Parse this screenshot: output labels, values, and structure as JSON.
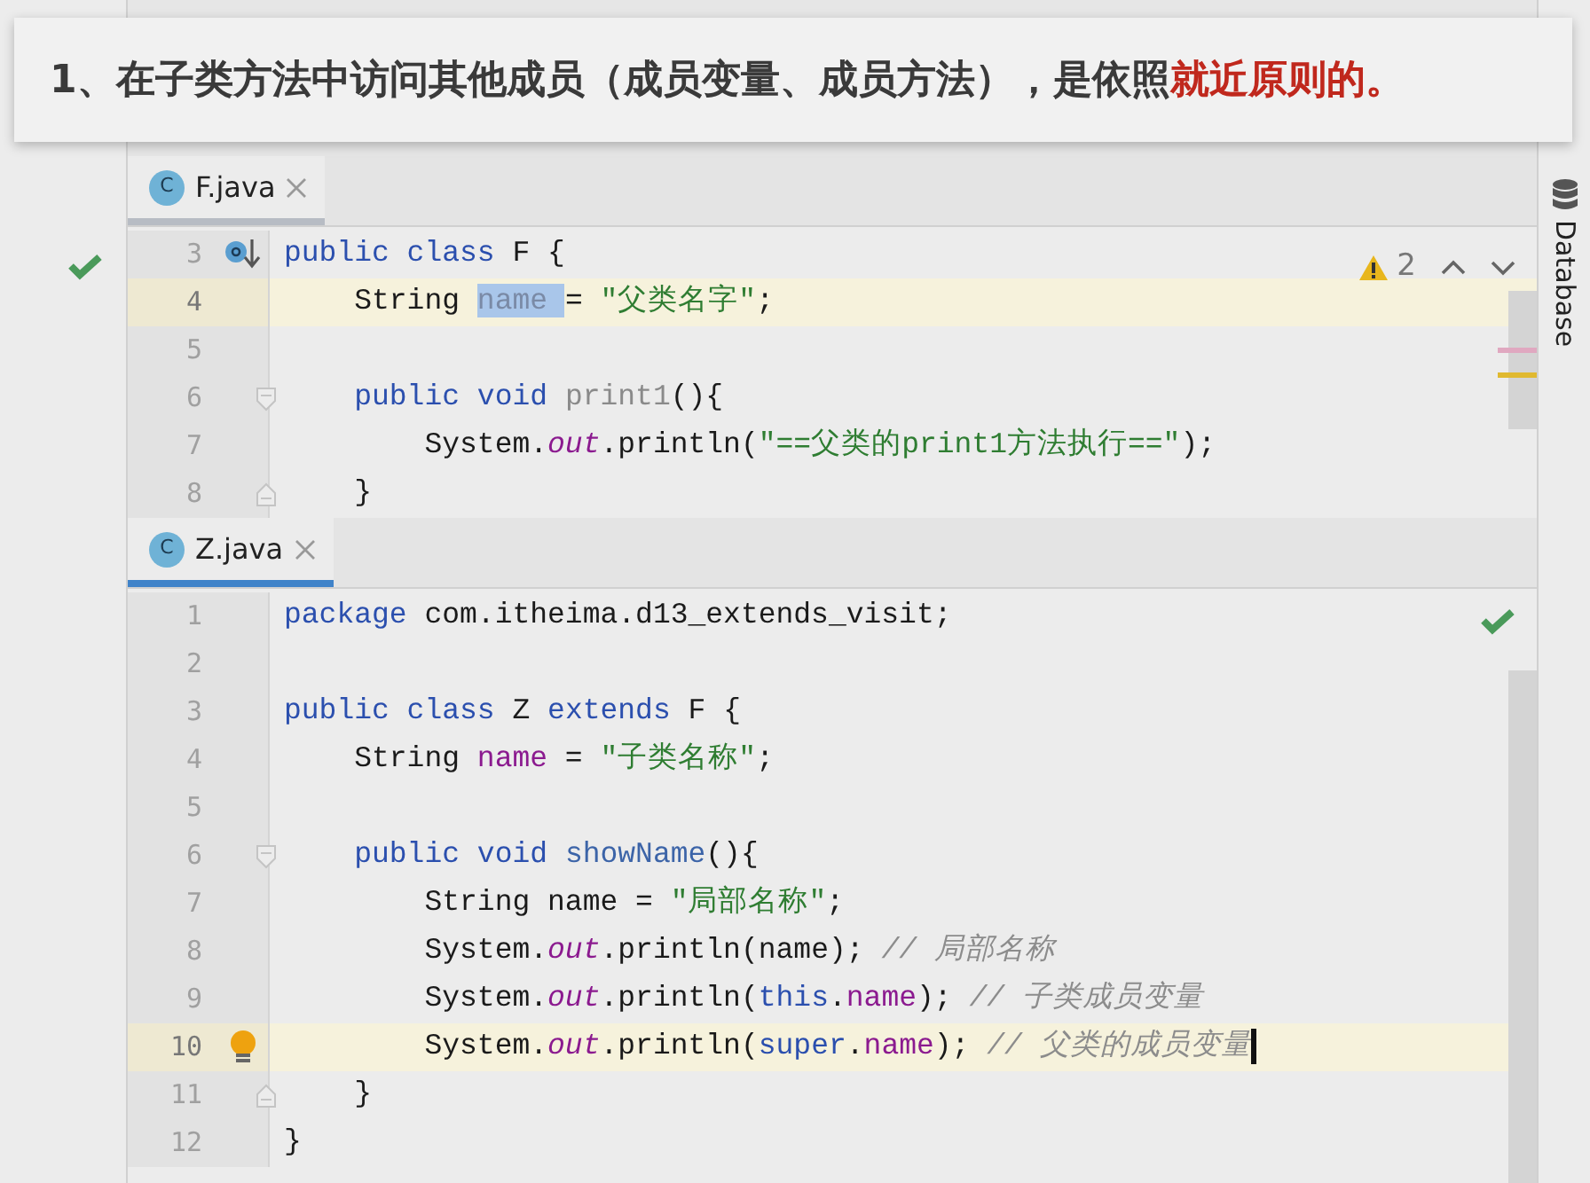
{
  "banner": {
    "segments": [
      {
        "text": "1、在子类方法中访问其他成员（成员变量、成员方法），是依照",
        "highlight": false
      },
      {
        "text": "就近原则的。",
        "highlight": true
      }
    ]
  },
  "left_panel": {
    "ok": true
  },
  "right_sidebar": {
    "label": "Database"
  },
  "panes": [
    {
      "tab": {
        "label": "F.java",
        "icon": "C",
        "focused": false
      },
      "inspection": {
        "kind": "warning",
        "warnings": "2"
      },
      "lines": [
        {
          "number": "3",
          "current": false,
          "kind": "implemented",
          "tokens": [
            {
              "t": "public class ",
              "kind": "kw"
            },
            {
              "t": "F {",
              "kind": "plain"
            }
          ]
        },
        {
          "number": "4",
          "current": true,
          "tokens": [
            {
              "t": "    String ",
              "kind": "plain"
            },
            {
              "t": "name ",
              "kind": "sel"
            },
            {
              "t": "= ",
              "kind": "plain"
            },
            {
              "t": "\"父类名字\"",
              "kind": "str"
            },
            {
              "t": ";",
              "kind": "plain"
            }
          ]
        },
        {
          "number": "5",
          "current": false
        },
        {
          "number": "6",
          "current": false,
          "kind": "fold-start",
          "tokens": [
            {
              "t": "    public void ",
              "kind": "kw"
            },
            {
              "t": "print1",
              "kind": "unused"
            },
            {
              "t": "(){",
              "kind": "plain"
            }
          ]
        },
        {
          "number": "7",
          "current": false,
          "tokens": [
            {
              "t": "        System.",
              "kind": "plain"
            },
            {
              "t": "out",
              "kind": "static"
            },
            {
              "t": ".println(",
              "kind": "plain"
            },
            {
              "t": "\"==父类的print1方法执行==\"",
              "kind": "str"
            },
            {
              "t": ");",
              "kind": "plain"
            }
          ]
        },
        {
          "number": "8",
          "current": false,
          "kind": "fold-end",
          "tokens": [
            {
              "t": "    }",
              "kind": "plain"
            }
          ]
        }
      ]
    },
    {
      "tab": {
        "label": "Z.java",
        "icon": "C",
        "focused": true
      },
      "inspection": {
        "kind": "ok"
      },
      "lines": [
        {
          "number": "1",
          "current": false,
          "tokens": [
            {
              "t": "package ",
              "kind": "kw"
            },
            {
              "t": "com.itheima.d13_extends_visit;",
              "kind": "plain"
            }
          ]
        },
        {
          "number": "2",
          "current": false
        },
        {
          "number": "3",
          "current": false,
          "tokens": [
            {
              "t": "public class ",
              "kind": "kw"
            },
            {
              "t": "Z ",
              "kind": "plain"
            },
            {
              "t": "extends ",
              "kind": "kw"
            },
            {
              "t": "F {",
              "kind": "plain"
            }
          ]
        },
        {
          "number": "4",
          "current": false,
          "tokens": [
            {
              "t": "    String ",
              "kind": "plain"
            },
            {
              "t": "name",
              "kind": "field"
            },
            {
              "t": " = ",
              "kind": "plain"
            },
            {
              "t": "\"子类名称\"",
              "kind": "str"
            },
            {
              "t": ";",
              "kind": "plain"
            }
          ]
        },
        {
          "number": "5",
          "current": false
        },
        {
          "number": "6",
          "current": false,
          "kind": "fold-start",
          "tokens": [
            {
              "t": "    public void ",
              "kind": "kw"
            },
            {
              "t": "showName",
              "kind": "method"
            },
            {
              "t": "(){",
              "kind": "plain"
            }
          ]
        },
        {
          "number": "7",
          "current": false,
          "tokens": [
            {
              "t": "        String name = ",
              "kind": "plain"
            },
            {
              "t": "\"局部名称\"",
              "kind": "str"
            },
            {
              "t": ";",
              "kind": "plain"
            }
          ]
        },
        {
          "number": "8",
          "current": false,
          "tokens": [
            {
              "t": "        System.",
              "kind": "plain"
            },
            {
              "t": "out",
              "kind": "static"
            },
            {
              "t": ".println(name); ",
              "kind": "plain"
            },
            {
              "t": "// 局部名称",
              "kind": "comment"
            }
          ]
        },
        {
          "number": "9",
          "current": false,
          "tokens": [
            {
              "t": "        System.",
              "kind": "plain"
            },
            {
              "t": "out",
              "kind": "static"
            },
            {
              "t": ".println(",
              "kind": "plain"
            },
            {
              "t": "this",
              "kind": "kw"
            },
            {
              "t": ".",
              "kind": "plain"
            },
            {
              "t": "name",
              "kind": "field"
            },
            {
              "t": "); ",
              "kind": "plain"
            },
            {
              "t": "// 子类成员变量",
              "kind": "comment"
            }
          ]
        },
        {
          "number": "10",
          "current": true,
          "caret": true,
          "kind": "bulb",
          "tokens": [
            {
              "t": "        System.",
              "kind": "plain"
            },
            {
              "t": "out",
              "kind": "static"
            },
            {
              "t": ".println(",
              "kind": "plain"
            },
            {
              "t": "super",
              "kind": "kw"
            },
            {
              "t": ".",
              "kind": "plain"
            },
            {
              "t": "name",
              "kind": "field"
            },
            {
              "t": "); ",
              "kind": "plain"
            },
            {
              "t": "// 父类的成员变量",
              "kind": "comment"
            }
          ]
        },
        {
          "number": "11",
          "current": false,
          "kind": "fold-end",
          "tokens": [
            {
              "t": "    }",
              "kind": "plain"
            }
          ]
        },
        {
          "number": "12",
          "current": false,
          "tokens": [
            {
              "t": "}",
              "kind": "plain"
            }
          ]
        }
      ]
    }
  ]
}
